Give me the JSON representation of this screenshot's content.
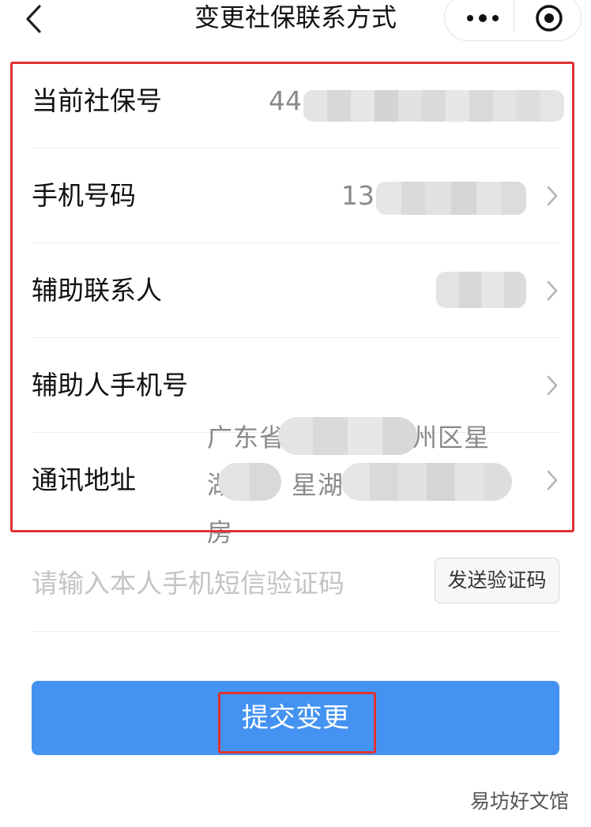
{
  "nav": {
    "title": "变更社保联系方式"
  },
  "form": {
    "social_security_no": {
      "label": "当前社保号",
      "value_visible": "44"
    },
    "phone": {
      "label": "手机号码",
      "value_visible": "13"
    },
    "assist_contact": {
      "label": "辅助联系人"
    },
    "assist_phone": {
      "label": "辅助人手机号"
    },
    "address": {
      "label": "通讯地址",
      "line1_prefix": "广东省",
      "line1_suffix": "州区星",
      "line2_prefix": "湖",
      "line2_mid": "星湖",
      "line3": "房"
    }
  },
  "sms": {
    "placeholder": "请输入本人手机短信验证码",
    "send_button": "发送验证码"
  },
  "submit": {
    "label": "提交变更"
  },
  "watermark": "易坊好文馆",
  "colors": {
    "primary_button": "#4493f2",
    "highlight": "#e03131"
  },
  "icons": {
    "back": "chevron-left-icon",
    "more": "more-dots-icon",
    "close": "target-circle-icon",
    "row_arrow": "chevron-right-icon"
  }
}
